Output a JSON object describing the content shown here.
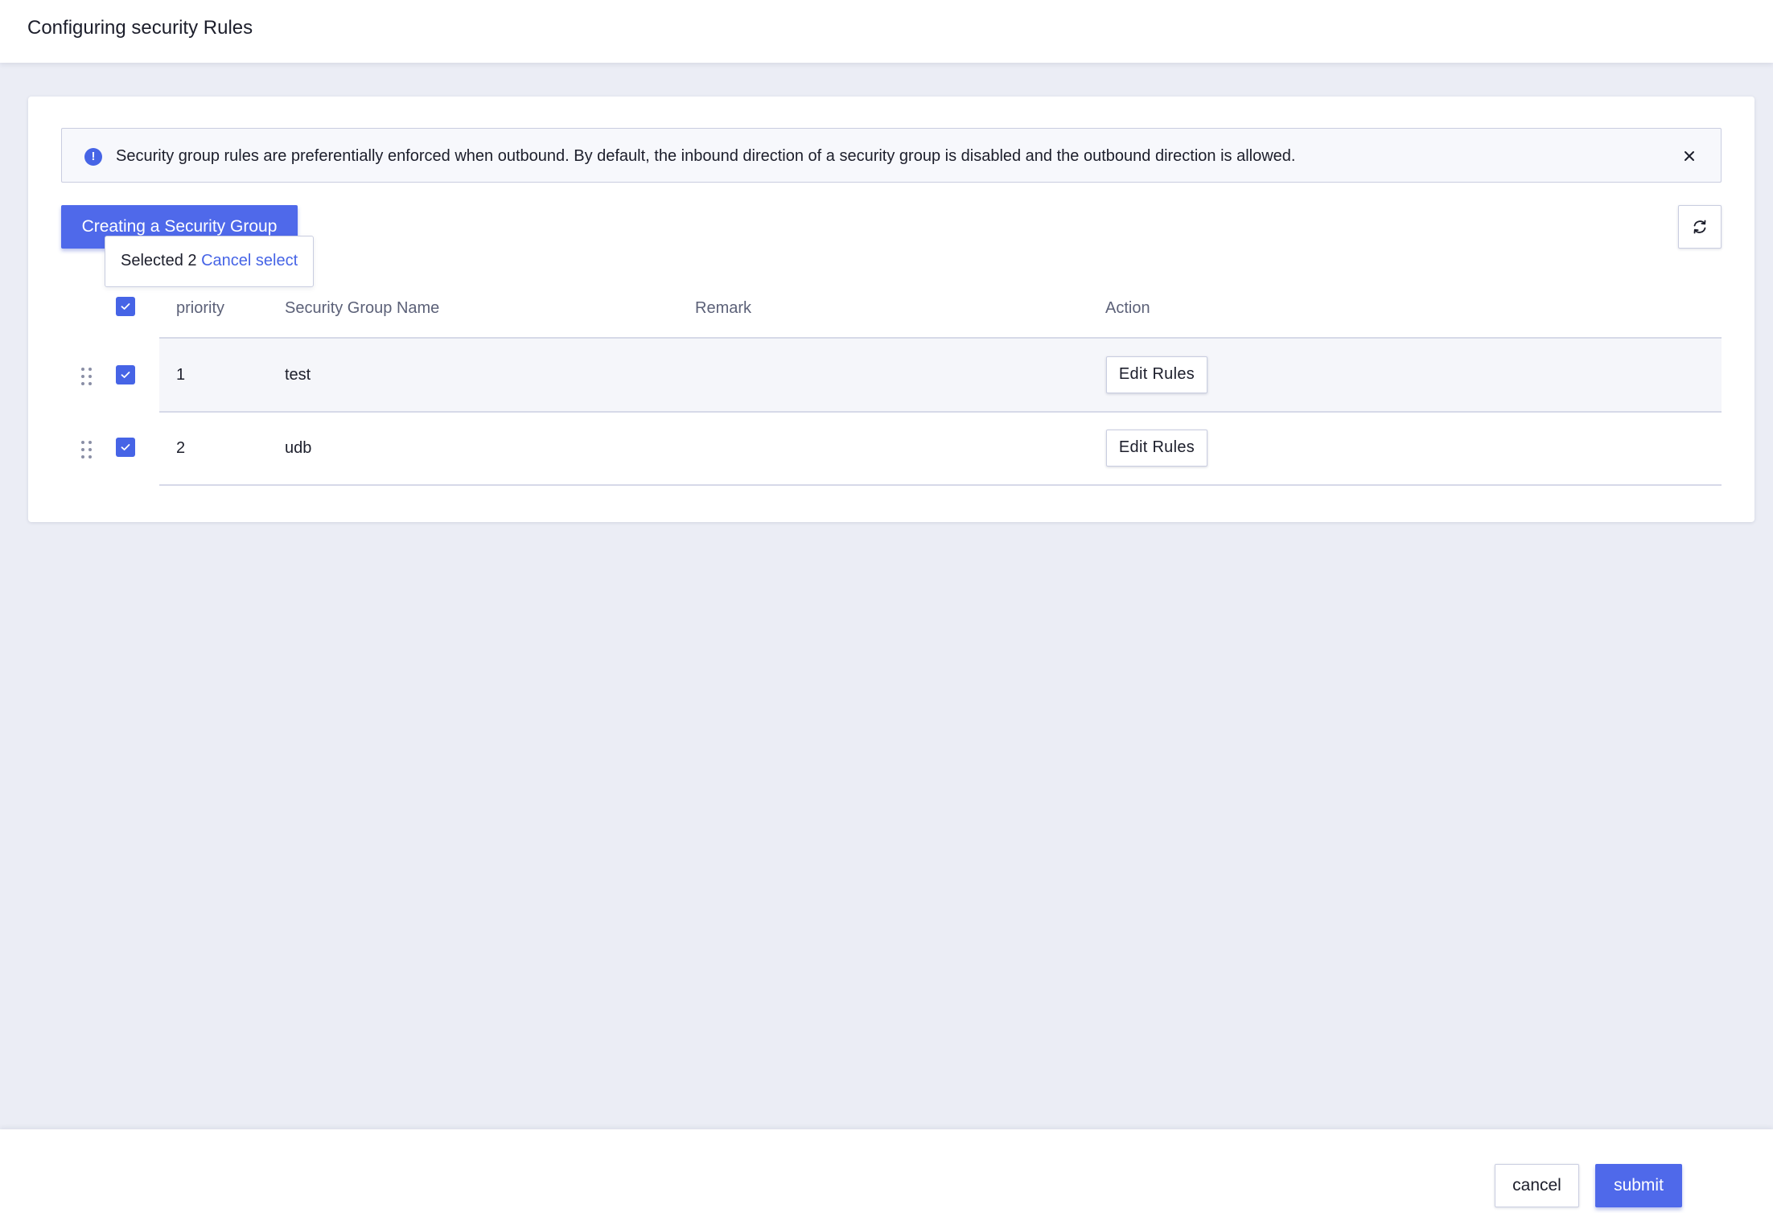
{
  "page": {
    "title": "Configuring security Rules"
  },
  "notice": {
    "icon": "info-icon",
    "message": "Security group rules are preferentially enforced when outbound. By default, the inbound direction of a security group is disabled and the outbound direction is allowed.",
    "close_icon": "close-icon"
  },
  "toolbar": {
    "create_label": "Creating a Security Group",
    "refresh_icon": "refresh-icon"
  },
  "selection": {
    "selected_label": "Selected 2",
    "cancel_label": "Cancel select"
  },
  "table": {
    "columns": {
      "priority": "priority",
      "name": "Security Group Name",
      "remark": "Remark",
      "action": "Action"
    },
    "select_all_checked": true,
    "rows": [
      {
        "priority": "1",
        "name": "test",
        "remark": "",
        "action_label": "Edit Rules",
        "checked": true
      },
      {
        "priority": "2",
        "name": "udb",
        "remark": "",
        "action_label": "Edit Rules",
        "checked": true
      }
    ]
  },
  "footer": {
    "cancel_label": "cancel",
    "submit_label": "submit"
  },
  "colors": {
    "accent": "#4f69ea",
    "link": "#4664e6",
    "background": "#ebedf5"
  }
}
